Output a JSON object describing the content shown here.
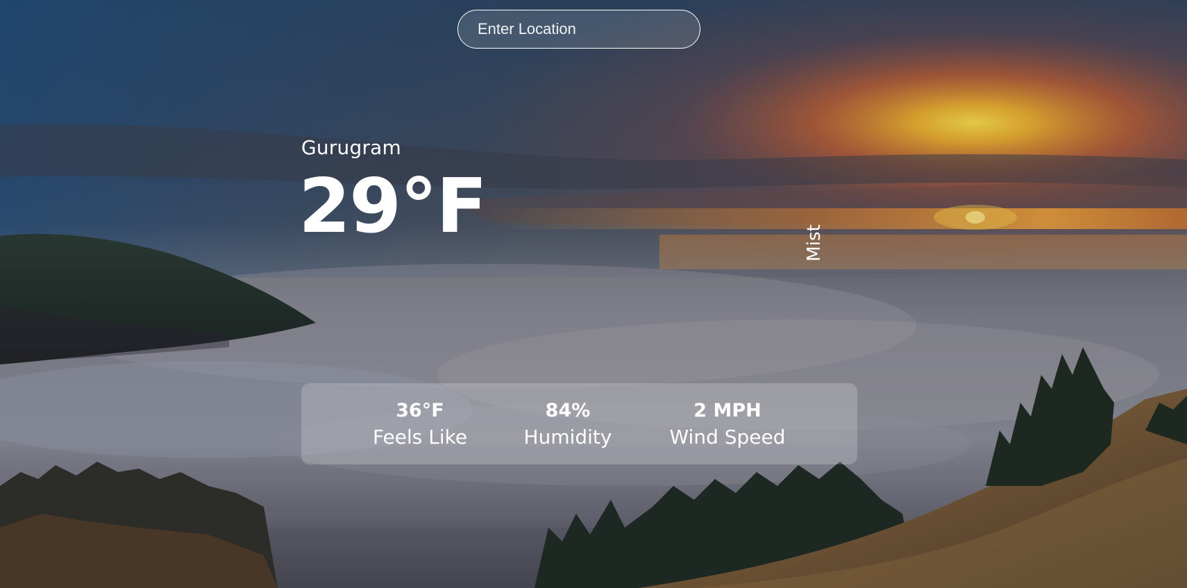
{
  "search": {
    "placeholder": "Enter Location",
    "value": ""
  },
  "weather": {
    "location": "Gurugram",
    "temperature": "29°F",
    "condition": "Mist"
  },
  "stats": [
    {
      "value": "36°F",
      "label": "Feels Like"
    },
    {
      "value": "84%",
      "label": "Humidity"
    },
    {
      "value": "2 MPH",
      "label": "Wind Speed"
    }
  ],
  "background": {
    "scene": "sunset over sea of clouds with forested hills",
    "sky_top": "#2f4a68",
    "sun": "#f7c531",
    "horizon_orange": "#e07a2a",
    "cloud": "#8a8d98",
    "forest": "#1e2a22",
    "hillside": "#7c5b35"
  }
}
